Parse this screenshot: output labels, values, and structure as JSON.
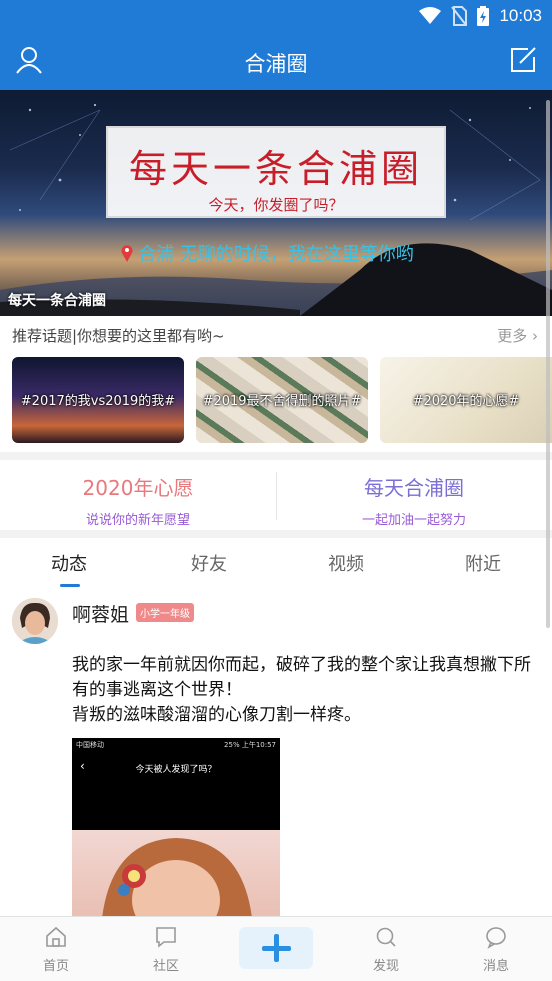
{
  "status_bar": {
    "time": "10:03",
    "icons": [
      "wifi-icon",
      "no-sim-icon",
      "battery-charging-icon"
    ]
  },
  "header": {
    "title": "合浦圈",
    "left_icon": "user-icon",
    "right_icon": "edit-icon",
    "color": "#1f7bd6"
  },
  "banner": {
    "card_title": "每天一条合浦圈",
    "card_subtitle": "今天，你发圈了吗？",
    "location_text": "合浦   无聊的时候，我在这里等你哟",
    "caption": "每天一条合浦圈"
  },
  "topics": {
    "title": "推荐话题|你想要的这里都有哟~",
    "more_label": "更多",
    "items": [
      {
        "label": "#2017的我vs2019的我#"
      },
      {
        "label": "#2019最不舍得删的照片#"
      },
      {
        "label": "#2020年的心愿#"
      }
    ]
  },
  "wishes": [
    {
      "title": "2020年心愿",
      "subtitle": "说说你的新年愿望",
      "color": "#e8787c",
      "sub_color": "#9a5bd6"
    },
    {
      "title": "每天合浦圈",
      "subtitle": "一起加油一起努力",
      "color": "#7a6fd6",
      "sub_color": "#9a5bd6"
    }
  ],
  "tabs": [
    {
      "label": "动态",
      "active": true
    },
    {
      "label": "好友",
      "active": false
    },
    {
      "label": "视频",
      "active": false
    },
    {
      "label": "附近",
      "active": false
    }
  ],
  "post": {
    "author": "啊蓉姐",
    "badge": "小学一年级",
    "text": "我的家一年前就因你而起，破碎了我的整个家让我真想撇下所有的事逃离这个世界！\n背叛的滋味酸溜溜的心像刀割一样疼。",
    "image": {
      "status_left": "中国移动",
      "status_right": "25% 上午10:57",
      "title": "今天被人发现了吗？"
    }
  },
  "bottom_nav": [
    {
      "label": "首页",
      "icon": "home-icon"
    },
    {
      "label": "社区",
      "icon": "chat-square-icon"
    },
    {
      "label": "",
      "icon": "plus-icon"
    },
    {
      "label": "发现",
      "icon": "search-icon"
    },
    {
      "label": "消息",
      "icon": "message-icon"
    }
  ]
}
